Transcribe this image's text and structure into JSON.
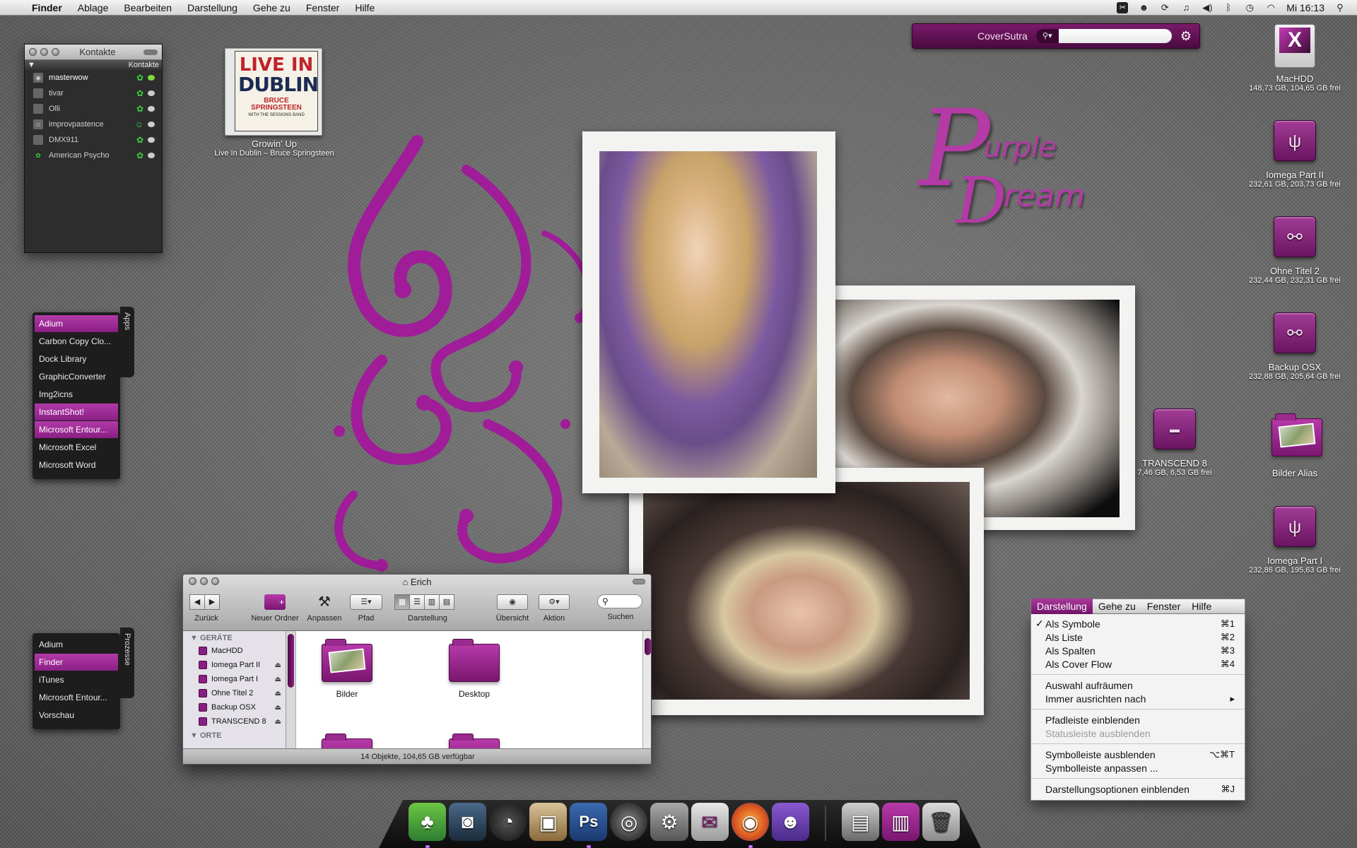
{
  "menubar": {
    "app": "Finder",
    "items": [
      "Ablage",
      "Bearbeiten",
      "Darstellung",
      "Gehe zu",
      "Fenster",
      "Hilfe"
    ],
    "clock": "Mi 16:13",
    "status_icons": [
      "scissors-icon",
      "robot-icon",
      "sync-icon",
      "music-note-icon",
      "volume-icon",
      "bluetooth-icon",
      "time-machine-icon",
      "wifi-icon",
      "spotlight-icon"
    ]
  },
  "coversutra": {
    "title": "CoverSutra",
    "search_value": ""
  },
  "contacts": {
    "title": "Kontakte",
    "group": "Kontakte",
    "rows": [
      {
        "name": "masterwow"
      },
      {
        "name": "tivar"
      },
      {
        "name": "Olli"
      },
      {
        "name": "improvpastence"
      },
      {
        "name": "DMX911"
      },
      {
        "name": "American Psycho"
      }
    ]
  },
  "album": {
    "line1": "LIVE IN",
    "line2": "DUBLIN",
    "line3": "BRUCE SPRINGSTEEN",
    "line4": "WITH THE SESSIONS BAND",
    "track": "Growin' Up",
    "subtitle": "Live In Dublin – Bruce Springsteen"
  },
  "apps_drawer": {
    "tab": "Apps",
    "items": [
      {
        "label": "Adium",
        "highlighted": true
      },
      {
        "label": "Carbon Copy Clo...",
        "highlighted": false
      },
      {
        "label": "Dock Library",
        "highlighted": false
      },
      {
        "label": "GraphicConverter",
        "highlighted": false
      },
      {
        "label": "Img2icns",
        "highlighted": false
      },
      {
        "label": "InstantShot!",
        "highlighted": true
      },
      {
        "label": "Microsoft Entour...",
        "highlighted": true
      },
      {
        "label": "Microsoft Excel",
        "highlighted": false
      },
      {
        "label": "Microsoft Word",
        "highlighted": false
      }
    ]
  },
  "process_drawer": {
    "tab": "Prozesse",
    "items": [
      {
        "label": "Adium",
        "highlighted": false
      },
      {
        "label": "Finder",
        "highlighted": true
      },
      {
        "label": "iTunes",
        "highlighted": false
      },
      {
        "label": "Microsoft Entour...",
        "highlighted": false
      },
      {
        "label": "Vorschau",
        "highlighted": false
      }
    ]
  },
  "logo": {
    "P": "P",
    "urple": "urple",
    "D": "D",
    "ream": "ream"
  },
  "desktop_icons": [
    {
      "label": "MacHDD",
      "sub": "148,73 GB, 104,65 GB frei",
      "icon": "hard-disk-icon"
    },
    {
      "label": "Iomega Part II",
      "sub": "232,61 GB, 203,73 GB frei",
      "icon": "usb-drive-icon"
    },
    {
      "label": "Ohne Titel 2",
      "sub": "232,44 GB, 232,31 GB frei",
      "icon": "firewire-drive-icon"
    },
    {
      "label": "Backup OSX",
      "sub": "232,88 GB, 205,64 GB frei",
      "icon": "firewire-drive-icon"
    },
    {
      "label": "TRANSCEND 8",
      "sub": "7,46 GB, 6,53 GB frei",
      "icon": "external-drive-icon"
    },
    {
      "label": "Bilder Alias",
      "sub": "",
      "icon": "folder-icon"
    },
    {
      "label": "Iomega Part I",
      "sub": "232,86 GB, 195,63 GB frei",
      "icon": "usb-drive-icon"
    }
  ],
  "finder": {
    "title": "Erich",
    "toolbar": {
      "back": "Zurück",
      "new_folder": "Neuer Ordner",
      "customize": "Anpassen",
      "path": "Pfad",
      "view": "Darstellung",
      "overview": "Übersicht",
      "action": "Aktion",
      "search": "Suchen",
      "search_value": ""
    },
    "sidebar": {
      "devices_header": "GERÄTE",
      "devices": [
        {
          "name": "MacHDD",
          "eject": false
        },
        {
          "name": "Iomega Part II",
          "eject": true
        },
        {
          "name": "Iomega Part I",
          "eject": true
        },
        {
          "name": "Ohne Titel 2",
          "eject": true
        },
        {
          "name": "Backup OSX",
          "eject": true
        },
        {
          "name": "TRANSCEND 8",
          "eject": true
        }
      ],
      "places_header": "ORTE"
    },
    "items": [
      {
        "name": "Bilder"
      },
      {
        "name": "Desktop"
      }
    ],
    "status": "14 Objekte, 104,65 GB verfügbar"
  },
  "view_menu": {
    "bar": [
      "Darstellung",
      "Gehe zu",
      "Fenster",
      "Hilfe"
    ],
    "groups": [
      [
        {
          "label": "Als Symbole",
          "shortcut": "⌘1",
          "checked": true,
          "disabled": false
        },
        {
          "label": "Als Liste",
          "shortcut": "⌘2",
          "checked": false,
          "disabled": false
        },
        {
          "label": "Als Spalten",
          "shortcut": "⌘3",
          "checked": false,
          "disabled": false
        },
        {
          "label": "Als Cover Flow",
          "shortcut": "⌘4",
          "checked": false,
          "disabled": false
        }
      ],
      [
        {
          "label": "Auswahl aufräumen",
          "shortcut": "",
          "checked": false,
          "disabled": false
        },
        {
          "label": "Immer ausrichten nach",
          "shortcut": "▸",
          "checked": false,
          "disabled": false
        }
      ],
      [
        {
          "label": "Pfadleiste einblenden",
          "shortcut": "",
          "checked": false,
          "disabled": false
        },
        {
          "label": "Statusleiste ausblenden",
          "shortcut": "",
          "checked": false,
          "disabled": true
        }
      ],
      [
        {
          "label": "Symbolleiste ausblenden",
          "shortcut": "⌥⌘T",
          "checked": false,
          "disabled": false
        },
        {
          "label": "Symbolleiste anpassen ...",
          "shortcut": "",
          "checked": false,
          "disabled": false
        }
      ],
      [
        {
          "label": "Darstellungsoptionen einblenden",
          "shortcut": "⌘J",
          "checked": false,
          "disabled": false
        }
      ]
    ]
  },
  "dock": {
    "apps": [
      {
        "icon": "adium-icon",
        "running": true
      },
      {
        "icon": "instantshot-icon",
        "running": false
      },
      {
        "icon": "dashboard-icon",
        "running": false
      },
      {
        "icon": "iphoto-icon",
        "running": false
      },
      {
        "icon": "photoshop-icon",
        "running": true
      },
      {
        "icon": "speaker-icon",
        "running": false
      },
      {
        "icon": "system-preferences-icon",
        "running": false
      },
      {
        "icon": "mail-icon",
        "running": false
      },
      {
        "icon": "firefox-icon",
        "running": true
      },
      {
        "icon": "adium-duck-icon",
        "running": false
      }
    ],
    "docs": [
      {
        "icon": "pictures-stack-icon"
      },
      {
        "icon": "documents-stack-icon"
      },
      {
        "icon": "trash-icon"
      }
    ]
  },
  "colors": {
    "accent": "#8a1f84",
    "accent_light": "#b43aa6"
  }
}
